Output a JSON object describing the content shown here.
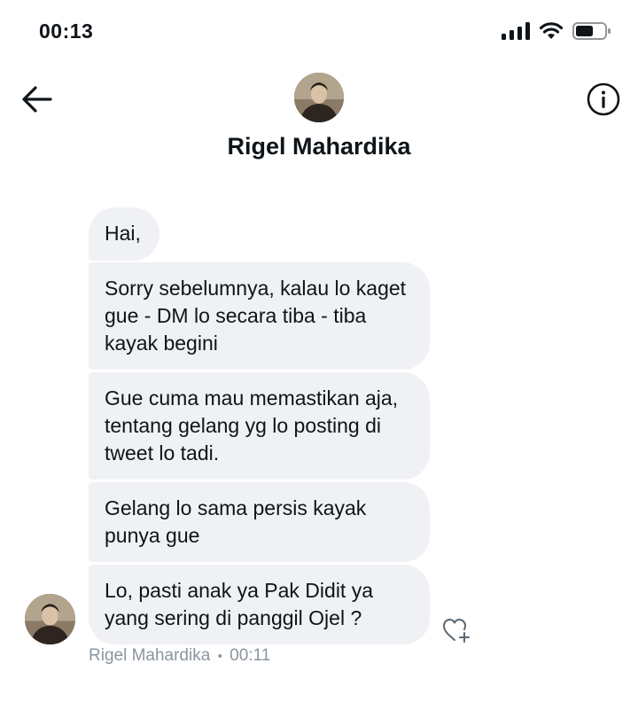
{
  "status_bar": {
    "time": "00:13",
    "icons": [
      "signal-icon",
      "wifi-icon",
      "battery-icon"
    ]
  },
  "header": {
    "back_icon": "arrow-left-icon",
    "info_icon": "info-icon",
    "name": "Rigel Mahardika"
  },
  "messages": [
    {
      "text": "Hai,"
    },
    {
      "text": "Sorry sebelumnya, kalau lo kaget gue - DM lo secara tiba - tiba kayak begini"
    },
    {
      "text": "Gue cuma mau memastikan aja, tentang gelang yg lo posting di tweet lo tadi."
    },
    {
      "text": "Gelang lo sama persis kayak punya gue"
    },
    {
      "text": "Lo, pasti anak ya Pak Didit ya yang sering di panggil Ojel ?"
    }
  ],
  "meta": {
    "sender": "Rigel Mahardika",
    "separator": "•",
    "time": "00:11"
  },
  "reaction_icon": "heart-plus-icon",
  "colors": {
    "bubble_bg": "#eff1f4",
    "text": "#0f1419",
    "meta": "#8b959e"
  }
}
